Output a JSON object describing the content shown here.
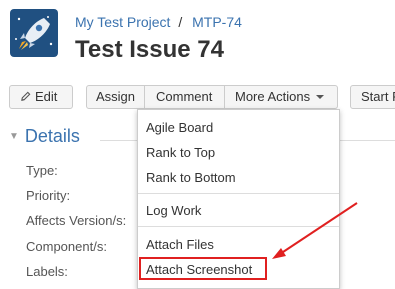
{
  "header": {
    "breadcrumb": {
      "project": "My Test Project",
      "separator": "/",
      "issue_key": "MTP-74"
    },
    "title": "Test Issue 74",
    "avatar_icon": "rocket-icon"
  },
  "toolbar": {
    "edit_label": "Edit",
    "edit_icon": "pencil-icon",
    "assign_label": "Assign",
    "comment_label": "Comment",
    "more_actions_label": "More Actions",
    "start_label": "Start P"
  },
  "details": {
    "heading": "Details",
    "fields": [
      "Type:",
      "Priority:",
      "Affects Version/s:",
      "Component/s:",
      "Labels:"
    ]
  },
  "more_actions_menu": {
    "items": [
      "Agile Board",
      "Rank to Top",
      "Rank to Bottom",
      "Log Work",
      "Attach Files",
      "Attach Screenshot"
    ]
  },
  "annotation": {
    "highlight_color": "#e02020",
    "highlighted_item": "Attach Screenshot"
  },
  "colors": {
    "link": "#3b73af",
    "avatar_bg": "#205081"
  }
}
